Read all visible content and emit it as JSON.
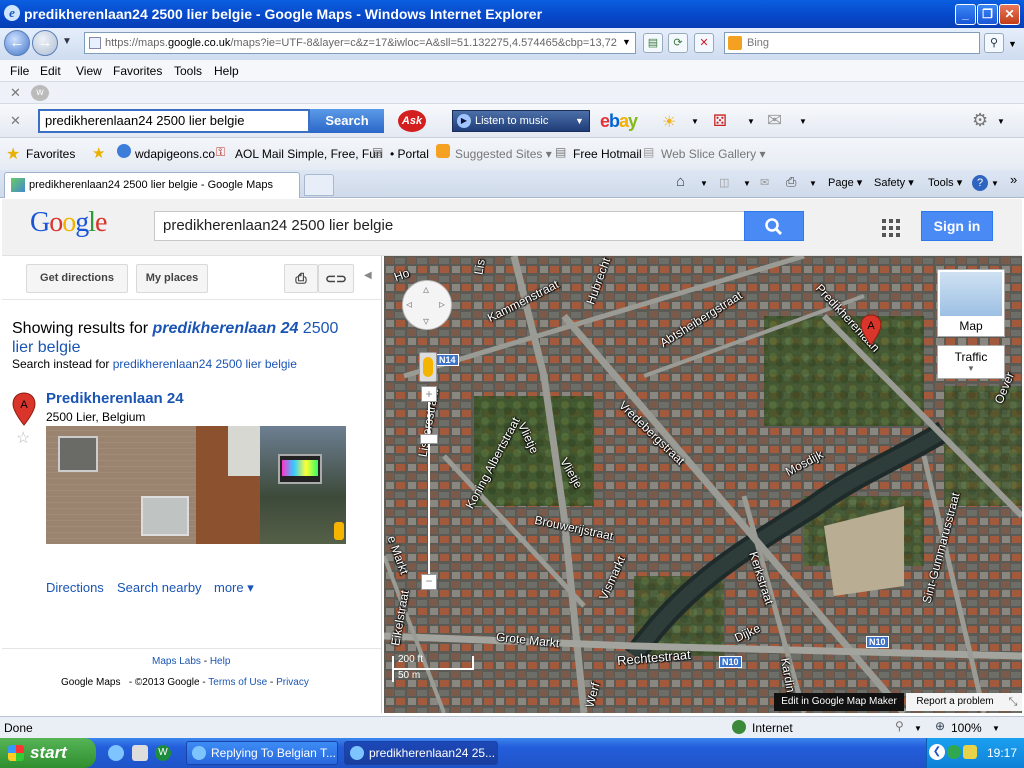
{
  "window": {
    "title": "predikherenlaan24 2500 lier belgie - Google Maps - Windows Internet Explorer"
  },
  "address_bar": {
    "url_prefix": "https://maps.",
    "url_domain": "google.co.uk",
    "url_rest": "/maps?ie=UTF-8&layer=c&z=17&iwloc=A&sll=51.132275,4.574465&cbp=13,72",
    "bing_placeholder": "Bing"
  },
  "menu": [
    "File",
    "Edit",
    "View",
    "Favorites",
    "Tools",
    "Help"
  ],
  "ask_toolbar": {
    "query": "predikherenlaan24 2500 lier belgie",
    "search_label": "Search",
    "ask_label": "Ask",
    "music_label": "Listen to music",
    "ebay_label": "ebay"
  },
  "favorites": {
    "label": "Favorites",
    "items": [
      "wdapigeons.co",
      "AOL Mail Simple, Free, Fun",
      "• Portal",
      "Suggested Sites ▾",
      "Free Hotmail",
      "Web Slice Gallery ▾"
    ]
  },
  "tab": {
    "title": "predikherenlaan24 2500 lier belgie - Google Maps"
  },
  "command_bar": {
    "page": "Page ▾",
    "safety": "Safety ▾",
    "tools": "Tools ▾"
  },
  "google": {
    "logo": "Google",
    "query": "predikherenlaan24 2500 lier belgie",
    "signin": "Sign in",
    "get_directions": "Get directions",
    "my_places": "My places",
    "showing_prefix": "Showing results for ",
    "showing_bold": "predikherenlaan 24",
    "showing_rest": " 2500 lier belgie",
    "instead_prefix": "Search instead for ",
    "instead_link": "predikherenlaan24 2500 lier belgie",
    "result_marker": "A",
    "result_title": "Predikherenlaan 24",
    "result_address": "2500 Lier, Belgium",
    "links": {
      "directions": "Directions",
      "nearby": "Search nearby",
      "more": "more ▾"
    },
    "footer_labs": "Maps Labs",
    "footer_sep": " - ",
    "footer_help": "Help",
    "footer_copy": "Google Maps   - ©2013 Google - ",
    "footer_terms": "Terms of Use",
    "footer_privacy": "Privacy"
  },
  "map": {
    "type_label": "Map",
    "traffic_label": "Traffic",
    "marker": "A",
    "scale_ft": "200 ft",
    "scale_m": "50 m",
    "edit_label": "Edit in Google Map Maker",
    "report_label": "Report a problem",
    "road_n14": "N14",
    "road_n10a": "N10",
    "road_n10b": "N10",
    "streets": {
      "kammenstraat": "Kammenstraat",
      "abtsheide": "Abtsheibergstraat",
      "predik": "Predikherenlaan",
      "vredebergstraat": "Vredebergstraat",
      "mosdijk": "Mosdijk",
      "koning": "Koning Albertstraat",
      "vlietje1": "Vlietje",
      "vlietje2": "Vlietje",
      "brouwerij": "Brouwerijstraat",
      "vismarkt": "Vismarkt",
      "kerkstraat": "Kerkstraat",
      "grotemarkt": "Grote Markt",
      "rechtestraat": "Rechtestraat",
      "dijke": "Dijke",
      "gummarus": "Sint-Gummarusstraat",
      "eikelstraat": "Eikelstraat",
      "oever": "Oever",
      "ho": "Ho",
      "lis": "Lis",
      "lisp": "Lispersstraat",
      "hubrecht": "Hubrecht",
      "kard": "Kardinaal",
      "werf": "Werf",
      "emarkt": "e Markt"
    }
  },
  "status_bar": {
    "text": "Done",
    "zone": "Internet",
    "zoom": "100%"
  },
  "taskbar": {
    "start": "start",
    "tasks": [
      "Replying To Belgian T...",
      "predikherenlaan24 25..."
    ],
    "time": "19:17"
  },
  "colors": {
    "title_bar": "#0a5fe0",
    "google_blue": "#4a8af4",
    "link": "#1a55b5",
    "marker_red": "#d9352a",
    "taskbar": "#245edb",
    "start_green": "#3a9a3a"
  }
}
